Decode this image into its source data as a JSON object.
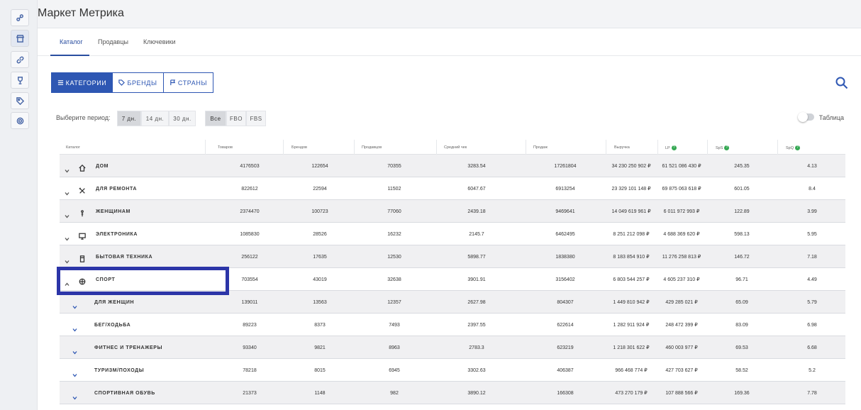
{
  "app": {
    "title": "Маркет Метрика"
  },
  "sidebar": {
    "items": [
      "analytics-icon",
      "store-icon",
      "link-icon",
      "trophy-icon",
      "tag-icon",
      "settings-icon"
    ]
  },
  "tabs": [
    {
      "label": "Каталог",
      "active": true
    },
    {
      "label": "Продавцы"
    },
    {
      "label": "Ключевики"
    }
  ],
  "segments": {
    "categories": "КАТЕГОРИИ",
    "brands": "БРЕНДЫ",
    "countries": "СТРАНЫ"
  },
  "period": {
    "label": "Выберите период:",
    "options": [
      "7 дн.",
      "14 дн.",
      "30 дн."
    ],
    "selected": "7 дн."
  },
  "fulfillment": {
    "options": [
      "Все",
      "FBO",
      "FBS"
    ],
    "selected": "Все"
  },
  "view_toggle": {
    "label": "Таблица",
    "on": false
  },
  "table": {
    "headers": [
      "Каталог",
      "Товаров",
      "Брендов",
      "Продавцов",
      "Средний чек",
      "Продаж",
      "Выручка",
      "LP",
      "SpS",
      "SpQ"
    ],
    "rows": [
      {
        "name": "ДОМ",
        "icon": "home-icon",
        "values": [
          "4176503",
          "122654",
          "70355",
          "3283.54",
          "17261804",
          "34 230 250 902 ₽",
          "61 521 086 430 ₽",
          "245.35",
          "4.13"
        ]
      },
      {
        "name": "ДЛЯ РЕМОНТА",
        "icon": "tools-icon",
        "values": [
          "822612",
          "22594",
          "11502",
          "6047.67",
          "6913254",
          "23 329 101 148 ₽",
          "69 875 063 618 ₽",
          "601.05",
          "8.4"
        ]
      },
      {
        "name": "ЖЕНЩИНАМ",
        "icon": "woman-icon",
        "values": [
          "2374470",
          "100723",
          "77060",
          "2439.18",
          "9469641",
          "14 049 619 961 ₽",
          "6 011 972 993 ₽",
          "122.89",
          "3.99"
        ]
      },
      {
        "name": "ЭЛЕКТРОНИКА",
        "icon": "monitor-icon",
        "values": [
          "1085830",
          "28526",
          "16232",
          "2145.7",
          "6462495",
          "8 251 212 098 ₽",
          "4 688 369 620 ₽",
          "598.13",
          "5.95"
        ]
      },
      {
        "name": "БЫТОВАЯ ТЕХНИКА",
        "icon": "appliance-icon",
        "values": [
          "256122",
          "17635",
          "12530",
          "5898.77",
          "1838380",
          "8 183 854 910 ₽",
          "11 276 258 813 ₽",
          "146.72",
          "7.18"
        ]
      },
      {
        "name": "СПОРТ",
        "icon": "ball-icon",
        "expanded": true,
        "values": [
          "703554",
          "43019",
          "32638",
          "3901.91",
          "3156402",
          "6 803 544 257 ₽",
          "4 605 237 310 ₽",
          "96.71",
          "4.49"
        ]
      }
    ],
    "subrows": [
      {
        "name": "ДЛЯ ЖЕНЩИН",
        "values": [
          "139011",
          "13563",
          "12357",
          "2627.98",
          "804307",
          "1 449 810 942 ₽",
          "429 285 021 ₽",
          "65.09",
          "5.79"
        ]
      },
      {
        "name": "БЕГ/ХОДЬБА",
        "values": [
          "89223",
          "8373",
          "7493",
          "2397.55",
          "622614",
          "1 282 911 924 ₽",
          "248 472 399 ₽",
          "83.09",
          "6.98"
        ]
      },
      {
        "name": "ФИТНЕС И ТРЕНАЖЕРЫ",
        "values": [
          "93340",
          "9821",
          "8963",
          "2783.3",
          "623219",
          "1 218 301 622 ₽",
          "460 003 977 ₽",
          "69.53",
          "6.68"
        ]
      },
      {
        "name": "ТУРИЗМ/ПОХОДЫ",
        "values": [
          "78218",
          "8015",
          "6945",
          "3302.63",
          "406387",
          "966 468 774 ₽",
          "427 703 627 ₽",
          "58.52",
          "5.2"
        ]
      },
      {
        "name": "СПОРТИВНАЯ ОБУВЬ",
        "values": [
          "21373",
          "1148",
          "982",
          "3890.12",
          "166308",
          "473 270 179 ₽",
          "107 888 566 ₽",
          "169.36",
          "7.78"
        ]
      }
    ]
  },
  "colors": {
    "accent": "#2e57b3",
    "highlight": "#2c35a8",
    "help_badge": "#35a853"
  }
}
